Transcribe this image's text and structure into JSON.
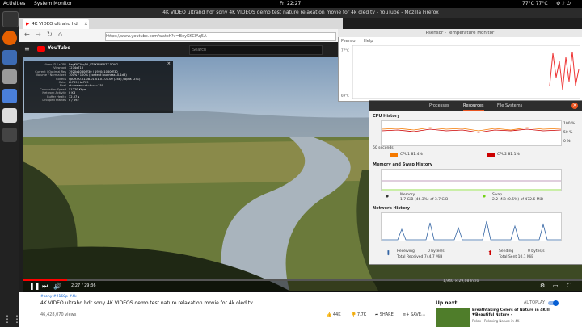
{
  "topbar": {
    "activities": "Activities",
    "app": "System Monitor",
    "clock": "Fri 22:27",
    "temps": "77°C 77°C"
  },
  "firefox": {
    "title": "4K VIDEO ultrahd hdr sony 4K VIDEOS demo test nature relaxation movie for 4k oled tv - YouTube - Mozilla Firefox",
    "tab_label": "4K VIDEO ultrahd hdr",
    "url": "https://www.youtube.com/watch?v=BeyKKCIAq5A"
  },
  "youtube": {
    "logo": "YouTube",
    "search_placeholder": "Search"
  },
  "stats": [
    {
      "k": "Video ID / sCPN",
      "v": "BeyKKCIAq5A / Z5K8 MW7Z 5DVG"
    },
    {
      "k": "Viewport",
      "v": "1274x715"
    },
    {
      "k": "Current / Optimal Res",
      "v": "1920x1080@30 / 1920x1080@30"
    },
    {
      "k": "Volume / Normalized",
      "v": "100% / 100% (content loudness -0.1dB)"
    },
    {
      "k": "Codecs",
      "v": "vp09.00.51.08.01.01.01.01.00 (248) / opus (251)"
    },
    {
      "k": "Color",
      "v": "bt709 / bt709"
    },
    {
      "k": "Pixel",
      "v": "ct~mean~ct~f~rt~150"
    },
    {
      "k": "Connection Speed",
      "v": "51270 Kbps"
    },
    {
      "k": "Network Activity",
      "v": "0 KB"
    },
    {
      "k": "Buffer Health",
      "v": "32.07 s"
    },
    {
      "k": "Dropped Frames",
      "v": "0 / 692"
    }
  ],
  "player": {
    "time": "2:27 / 29:36",
    "cursor": "1,940 × 29,08 Intro"
  },
  "below": {
    "hashtags": "#sony #2160p #4k",
    "video_title": "4K VIDEO ultrahd hdr sony 4K VIDEOS demo test nature relaxation movie for 4k oled tv",
    "views": "46,428,070 views",
    "likes": "44K",
    "dislikes": "7.7K",
    "share": "SHARE",
    "save": "SAVE",
    "up_next": "Up next",
    "autoplay": "AUTOPLAY",
    "next_title": "Breathtaking Colors of Nature in 4K II ♥Beautiful Nature -",
    "next_channel": "Relax - Relaxing Nature in 4K"
  },
  "psensor": {
    "title": "Psensor - Temperature Monitor",
    "menu_sensors": "Psensor",
    "menu_help": "Help",
    "ymax": "77°C",
    "ymin": "69°C"
  },
  "sysmon": {
    "tabs": [
      "Processes",
      "Resources",
      "File Systems"
    ],
    "cpu_title": "CPU History",
    "cpu1": "CPU1  81.4%",
    "cpu2": "CPU2  81.1%",
    "mem_title": "Memory and Swap History",
    "mem_label": "Memory",
    "mem_val": "1.7 GiB (46.3%) of 3.7 GiB",
    "swap_label": "Swap",
    "swap_val": "2.2 MiB (0.5%) of 472.6 MiB",
    "net_title": "Network History",
    "recv_label": "Receiving",
    "recv_rate": "0 bytes/s",
    "recv_total": "Total Received  744.7 MiB",
    "send_label": "Sending",
    "send_rate": "0 bytes/s",
    "send_total": "Total Sent  10.1 MiB",
    "axis_60": "60 seconds",
    "axis_100": "100 %",
    "axis_50": "50 %",
    "axis_0": "0 %"
  },
  "colors": {
    "cpu1": "#f57900",
    "cpu2": "#cc0000",
    "mem": "#ad7fa8",
    "net_recv": "#3465a4",
    "net_send": "#ef2929",
    "yt_red": "#ff0000"
  }
}
